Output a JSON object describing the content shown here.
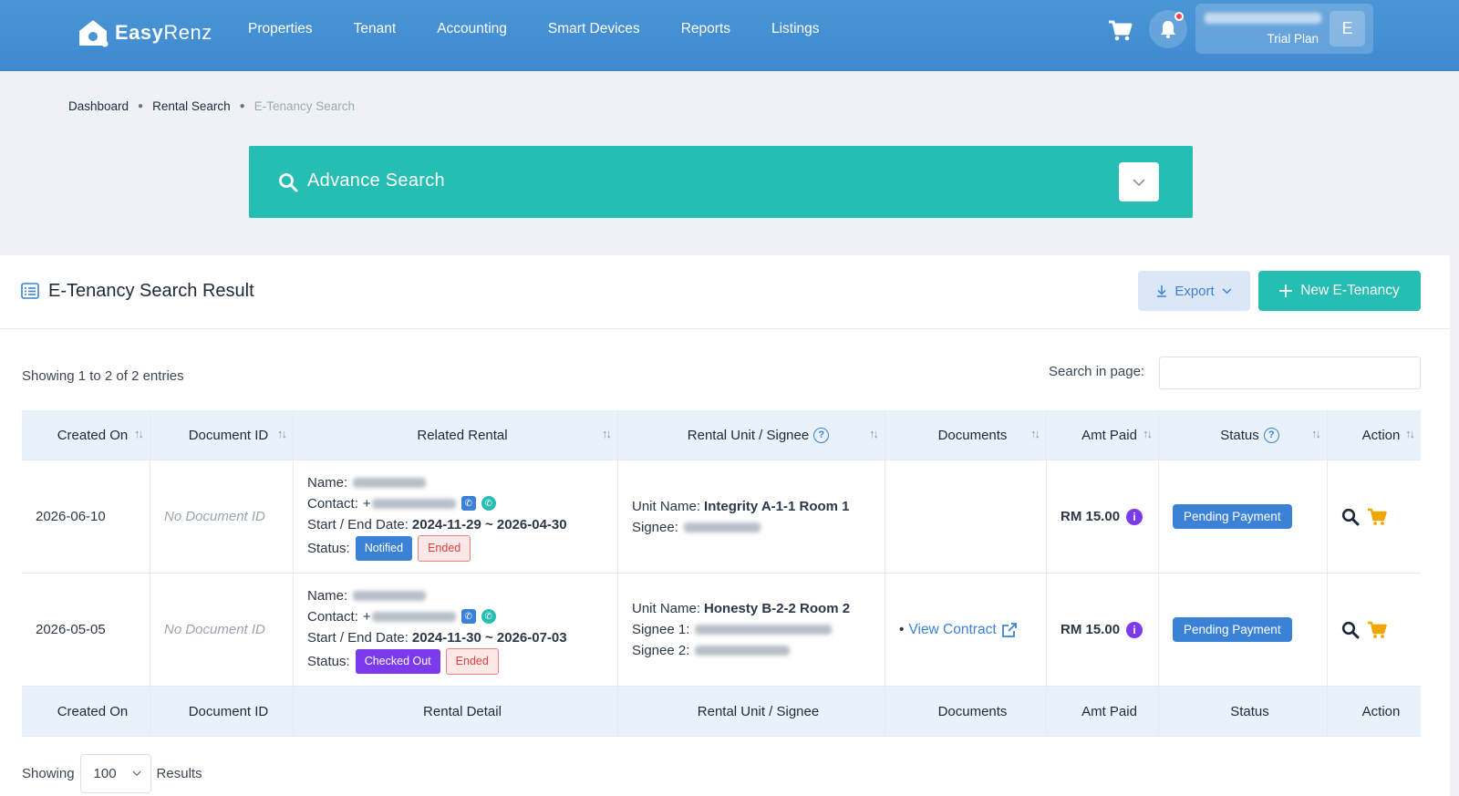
{
  "app": {
    "logo_text": "Easy",
    "logo_text2": "Renz"
  },
  "nav": [
    {
      "label": "Properties"
    },
    {
      "label": "Tenant"
    },
    {
      "label": "Accounting"
    },
    {
      "label": "Smart Devices"
    },
    {
      "label": "Reports"
    },
    {
      "label": "Listings"
    }
  ],
  "user": {
    "plan": "Trial Plan",
    "avatar_initial": "E"
  },
  "breadcrumb": [
    "Dashboard",
    "Rental Search",
    "E-Tenancy Search"
  ],
  "advance_search": {
    "label": "Advance Search"
  },
  "panel": {
    "title": "E-Tenancy Search Result",
    "export_label": "Export",
    "new_label": "New E-Tenancy",
    "showing": "Showing 1 to 2 of 2 entries",
    "search_label": "Search in page:"
  },
  "table": {
    "headers": [
      "Created On",
      "Document ID",
      "Related Rental",
      "Rental Unit / Signee",
      "Documents",
      "Amt Paid",
      "Status",
      "Action"
    ],
    "footers": [
      "Created On",
      "Document ID",
      "Rental Detail",
      "Rental Unit / Signee",
      "Documents",
      "Amt Paid",
      "Status",
      "Action"
    ],
    "rows": [
      {
        "created_on": "2026-06-10",
        "document_id": "No Document ID",
        "name_label": "Name:",
        "contact_label": "Contact:",
        "contact_prefix": "+",
        "dates_label": "Start / End Date:",
        "dates": "2024-11-29 ~ 2026-04-30",
        "status_label": "Status:",
        "status_tags": [
          "Notified",
          "Ended"
        ],
        "unit_label": "Unit Name:",
        "unit_name": "Integrity A-1-1 Room 1",
        "signee1_label": "Signee:",
        "documents": "",
        "amount": "RM 15.00",
        "status": "Pending Payment"
      },
      {
        "created_on": "2026-05-05",
        "document_id": "No Document ID",
        "name_label": "Name:",
        "contact_label": "Contact:",
        "contact_prefix": "+",
        "dates_label": "Start / End Date:",
        "dates": "2024-11-30 ~ 2026-07-03",
        "status_label": "Status:",
        "status_tags": [
          "Checked Out",
          "Ended"
        ],
        "unit_label": "Unit Name:",
        "unit_name": "Honesty B-2-2 Room 2",
        "signee1_label": "Signee 1:",
        "signee2_label": "Signee 2:",
        "documents": "View Contract",
        "amount": "RM 15.00",
        "status": "Pending Payment"
      }
    ]
  },
  "footer": {
    "showing": "Showing",
    "page_size": "100",
    "results": "Results"
  },
  "colors": {
    "topbar": "#4a95d6",
    "teal": "#26bdb3",
    "blue": "#3b82d6",
    "purple": "#7c3aed",
    "red": "#e53e3e"
  }
}
